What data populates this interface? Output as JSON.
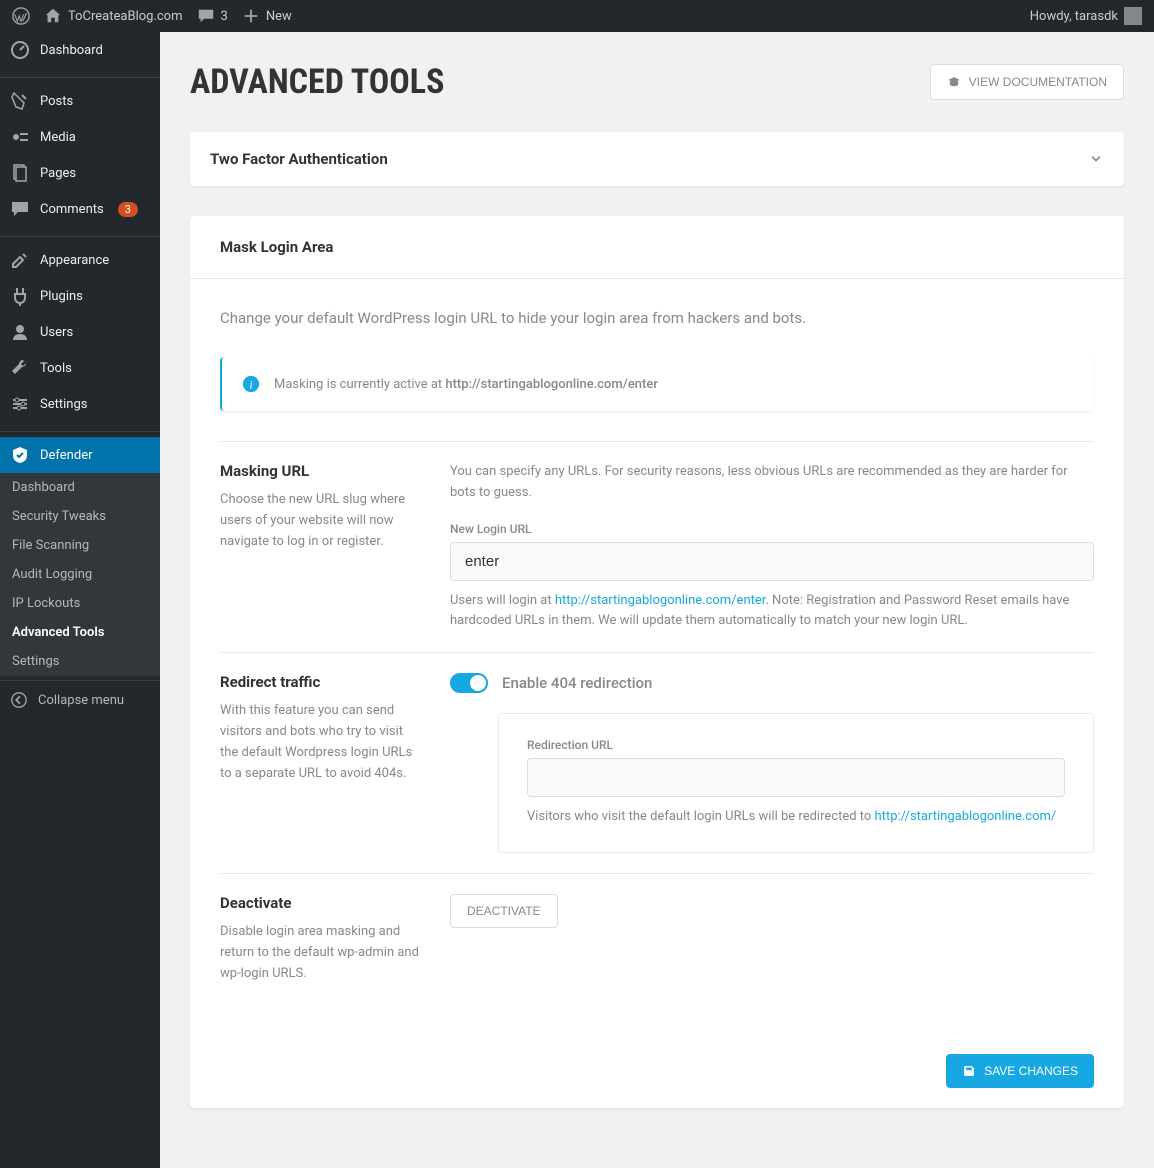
{
  "adminbar": {
    "site_name": "ToCreateaBlog.com",
    "comment_count": "3",
    "new_label": "New",
    "howdy": "Howdy, tarasdk"
  },
  "sidebar": {
    "dashboard": "Dashboard",
    "posts": "Posts",
    "media": "Media",
    "pages": "Pages",
    "comments": "Comments",
    "comments_count": "3",
    "appearance": "Appearance",
    "plugins": "Plugins",
    "users": "Users",
    "tools": "Tools",
    "settings": "Settings",
    "defender": "Defender",
    "sub": {
      "dashboard": "Dashboard",
      "security_tweaks": "Security Tweaks",
      "file_scanning": "File Scanning",
      "audit_logging": "Audit Logging",
      "ip_lockouts": "IP Lockouts",
      "advanced_tools": "Advanced Tools",
      "settings": "Settings"
    },
    "collapse": "Collapse menu"
  },
  "page": {
    "title": "ADVANCED TOOLS",
    "view_doc": "VIEW DOCUMENTATION"
  },
  "accordion": {
    "two_factor": "Two Factor Authentication"
  },
  "mask": {
    "header": "Mask Login Area",
    "desc": "Change your default WordPress login URL to hide your login area from hackers and bots.",
    "info_prefix": "Masking is currently active at ",
    "info_url": "http://startingablogonline.com/enter",
    "url_section": {
      "label": "Masking URL",
      "hint": "Choose the new URL slug where users of your website will now navigate to log in or register.",
      "help": "You can specify any URLs. For security reasons, less obvious URLs are recommended as they are harder for bots to guess.",
      "field_label": "New Login URL",
      "value": "enter",
      "note_a": "Users will login at ",
      "note_link": "http://startingablogonline.com/enter",
      "note_b": ". Note: Registration and Password Reset emails have hardcoded URLs in them. We will update them automatically to match your new login URL."
    },
    "redirect": {
      "label": "Redirect traffic",
      "hint": "With this feature you can send visitors and bots who try to visit the default Wordpress login URLs to a separate URL to avoid 404s.",
      "toggle_label": "Enable 404 redirection",
      "field_label": "Redirection URL",
      "value": "",
      "note_a": "Visitors who visit the default login URLs will be redirected to ",
      "note_link": "http://startingablogonline.com/"
    },
    "deactivate": {
      "label": "Deactivate",
      "hint": "Disable login area masking and return to the default wp-admin and wp-login URLS.",
      "button": "DEACTIVATE"
    },
    "save": "SAVE CHANGES"
  }
}
